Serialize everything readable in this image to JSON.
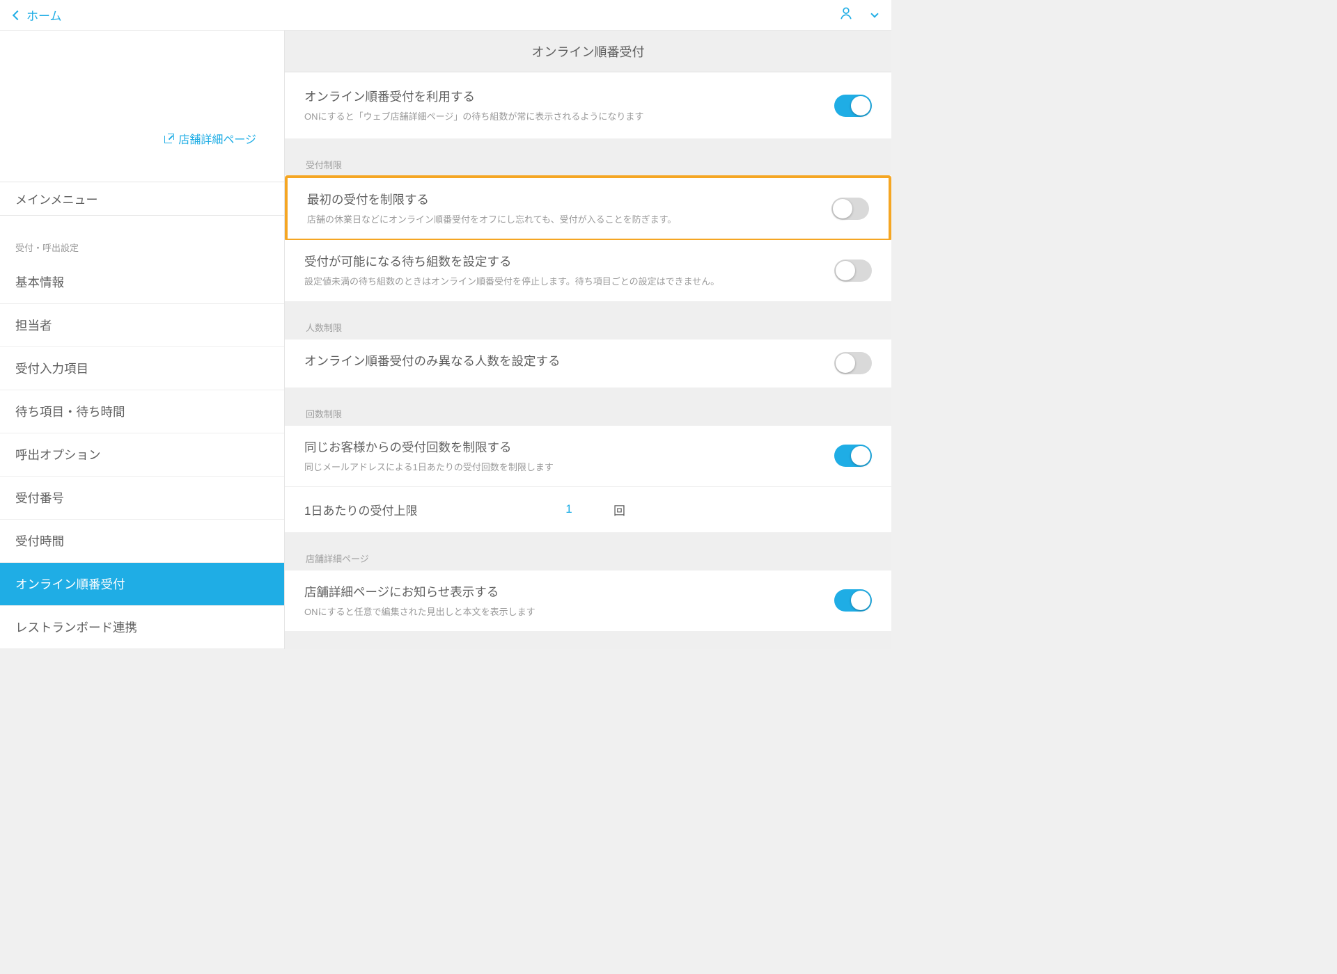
{
  "header": {
    "back_label": "ホーム"
  },
  "sidebar": {
    "store_link": "店舗詳細ページ",
    "main_menu_label": "メインメニュー",
    "section_label": "受付・呼出設定",
    "items": [
      "基本情報",
      "担当者",
      "受付入力項目",
      "待ち項目・待ち時間",
      "呼出オプション",
      "受付番号",
      "受付時間",
      "オンライン順番受付",
      "レストランボード連携"
    ],
    "active_index": 7
  },
  "content": {
    "title": "オンライン順番受付",
    "main_toggle": {
      "title": "オンライン順番受付を利用する",
      "desc": "ONにすると「ウェブ店舗詳細ページ」の待ち組数が常に表示されるようになります",
      "on": true
    },
    "groups": [
      {
        "label": "受付制限",
        "rows": [
          {
            "title": "最初の受付を制限する",
            "desc": "店舗の休業日などにオンライン順番受付をオフにし忘れても、受付が入ることを防ぎます。",
            "on": false,
            "highlight": true
          },
          {
            "title": "受付が可能になる待ち組数を設定する",
            "desc": "設定値未満の待ち組数のときはオンライン順番受付を停止します。待ち項目ごとの設定はできません。",
            "on": false
          }
        ]
      },
      {
        "label": "人数制限",
        "rows": [
          {
            "title": "オンライン順番受付のみ異なる人数を設定する",
            "desc": "",
            "on": false
          }
        ]
      },
      {
        "label": "回数制限",
        "rows": [
          {
            "title": "同じお客様からの受付回数を制限する",
            "desc": "同じメールアドレスによる1日あたりの受付回数を制限します",
            "on": true
          }
        ],
        "value_row": {
          "label": "1日あたりの受付上限",
          "value": "1",
          "unit": "回"
        }
      },
      {
        "label": "店舗詳細ページ",
        "rows": [
          {
            "title": "店舗詳細ページにお知らせ表示する",
            "desc": "ONにすると任意で編集された見出しと本文を表示します",
            "on": true
          }
        ]
      }
    ]
  }
}
